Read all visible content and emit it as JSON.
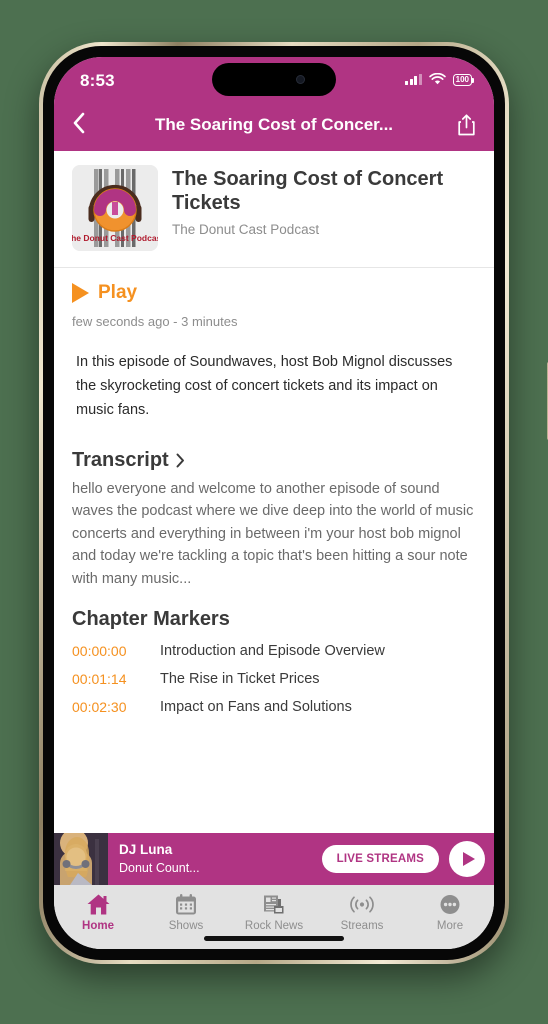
{
  "status_bar": {
    "time": "8:53",
    "battery_level": "100",
    "signal_icon": "cellular-signal-icon",
    "wifi_icon": "wifi-icon",
    "battery_icon": "battery-icon"
  },
  "nav_bar": {
    "back_icon": "chevron-left-icon",
    "title": "The Soaring Cost of Concer...",
    "share_icon": "share-icon",
    "background_color": "#b03483"
  },
  "episode": {
    "artwork_alt": "The Donut Cast Podcast",
    "artwork_caption": "The Donut Cast Podcast",
    "title": "The Soaring Cost of Concert Tickets",
    "show": "The Donut Cast Podcast",
    "play_label": "Play",
    "play_icon": "play-triangle-icon",
    "play_color": "#f59120",
    "meta": "few seconds ago - 3 minutes",
    "description": "In this episode of Soundwaves, host Bob Mignol discusses the skyrocketing cost of concert tickets and its impact on music fans."
  },
  "transcript": {
    "heading": "Transcript",
    "chevron_icon": "chevron-right-icon",
    "text": "hello everyone and welcome to another episode of sound waves the podcast where we dive deep into the world of music concerts and everything in between i'm your host bob mignol and today we're tackling a topic that's been hitting a sour note with many music..."
  },
  "chapters": {
    "heading": "Chapter Markers",
    "items": [
      {
        "time": "00:00:00",
        "name": "Introduction and Episode Overview"
      },
      {
        "time": "00:01:14",
        "name": "The Rise in Ticket Prices"
      },
      {
        "time": "00:02:30",
        "name": "Impact on Fans and Solutions"
      }
    ]
  },
  "mini_player": {
    "thumb_alt": "dj-luna-photo",
    "name": "DJ Luna",
    "subtitle": "Donut Count...",
    "live_button": "LIVE STREAMS",
    "play_icon": "play-circle-icon",
    "background_color": "#b03483"
  },
  "tab_bar": {
    "items": [
      {
        "label": "Home",
        "icon": "home-icon",
        "active": true
      },
      {
        "label": "Shows",
        "icon": "calendar-icon",
        "active": false
      },
      {
        "label": "Rock News",
        "icon": "newspaper-icon",
        "active": false
      },
      {
        "label": "Streams",
        "icon": "broadcast-icon",
        "active": false
      },
      {
        "label": "More",
        "icon": "ellipsis-icon",
        "active": false
      }
    ],
    "active_color": "#b03483",
    "inactive_color": "#8e8e8e"
  }
}
